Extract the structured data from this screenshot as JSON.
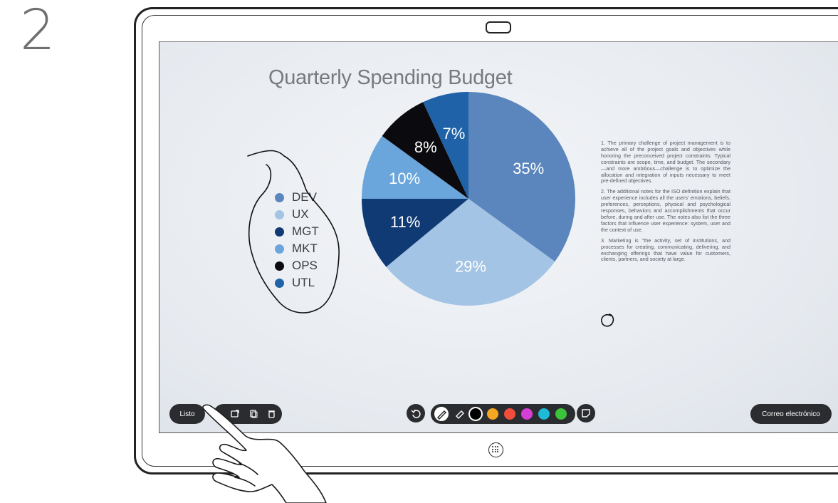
{
  "step": {
    "number": "2"
  },
  "slide": {
    "title": "Quarterly Spending Budget",
    "legend": [
      {
        "label": "DEV",
        "color": "#5b86bd"
      },
      {
        "label": "UX",
        "color": "#a3c4e4"
      },
      {
        "label": "MGT",
        "color": "#0f3a74"
      },
      {
        "label": "MKT",
        "color": "#6aa6db"
      },
      {
        "label": "OPS",
        "color": "#0b0b0f"
      },
      {
        "label": "UTL",
        "color": "#1f62a8"
      }
    ],
    "notes": [
      "1. The primary challenge of project management is to achieve all of the project goals and objectives while honoring the preconceived project constraints. Typical constraints are scope, time, and budget. The secondary—and more ambitious—challenge is to optimize the allocation and integration of inputs necessary to meet pre-defined objectives.",
      "2. The additional notes for the ISO definition explain that user experience includes all the users' emotions, beliefs, preferences, perceptions, physical and psychological responses, behaviors and accomplishments that occur before, during and after use. The notes also list the three factors that influence user experience: system, user and the context of use.",
      "3. Marketing is \"the activity, set of institutions, and processes for creating, communicating, delivering, and exchanging offerings that have value for customers, clients, partners, and society at large."
    ]
  },
  "chart_data": {
    "type": "pie",
    "categories": [
      "DEV",
      "UX",
      "MGT",
      "MKT",
      "OPS",
      "UTL"
    ],
    "values": [
      35,
      29,
      11,
      10,
      8,
      7
    ],
    "labels": [
      "35%",
      "29%",
      "11%",
      "10%",
      "8%",
      "7%"
    ],
    "colors": [
      "#5b86bd",
      "#a3c4e4",
      "#0f3a74",
      "#6aa6db",
      "#0b0b0f",
      "#1f62a8"
    ],
    "title": "Quarterly Spending Budget"
  },
  "toolbar": {
    "done_label": "Listo",
    "email_label": "Correo electrónico",
    "pen_colors": [
      "#000000",
      "#f5a623",
      "#f04e3a",
      "#d63fd6",
      "#1fbad6",
      "#3bc43b"
    ],
    "selected_color": "#000000"
  }
}
